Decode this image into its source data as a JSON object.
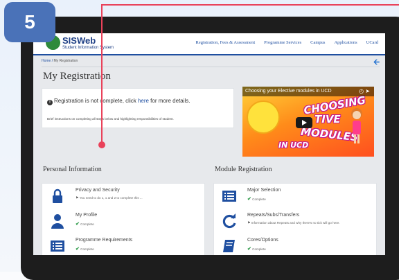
{
  "step_badge": "5",
  "app": {
    "name": "SISWeb",
    "subtitle": "Student Information System"
  },
  "topnav": [
    "Registration, Fees & Assessment",
    "Programme Services",
    "Campus",
    "Applications",
    "UCard"
  ],
  "breadcrumb": {
    "home": "Home",
    "separator": "/",
    "current": "My Registration"
  },
  "page_title": "My Registration",
  "notice": {
    "prefix": "Registration is not complete, click ",
    "link": "here",
    "suffix": " for more details.",
    "instructions": "Brief instructions on completing all steps below and highlighting responsibilities of student."
  },
  "video": {
    "title": "Choosing your Elective modules in UCD",
    "words": [
      "CHOOSING",
      "TIVE",
      "MODULES",
      "IN UCD"
    ]
  },
  "sections": {
    "personal": {
      "heading": "Personal Information",
      "items": [
        {
          "title": "Privacy and Security",
          "status": "You need to do 1, 1 and 2 to complete this ...",
          "status_kind": "flag",
          "icon": "lock-icon"
        },
        {
          "title": "My Profile",
          "status": "Complete",
          "status_kind": "complete",
          "icon": "user-icon"
        },
        {
          "title": "Programme Requirements",
          "status": "Complete",
          "status_kind": "complete",
          "icon": "list-icon"
        }
      ]
    },
    "module": {
      "heading": "Module Registration",
      "items": [
        {
          "title": "Major Selection",
          "status": "Complete",
          "status_kind": "complete",
          "icon": "list-icon"
        },
        {
          "title": "Repeats/Subs/Transfers",
          "status": "Information about Repeats and why there's no tick will go here.",
          "status_kind": "flag",
          "icon": "refresh-icon"
        },
        {
          "title": "Cores/Options",
          "status": "Complete",
          "status_kind": "complete",
          "icon": "book-icon"
        }
      ]
    }
  },
  "colors": {
    "annotation": "#e9425a",
    "badge": "#4a72b8",
    "brand": "#1e3f85",
    "complete": "#2e9b4a"
  }
}
